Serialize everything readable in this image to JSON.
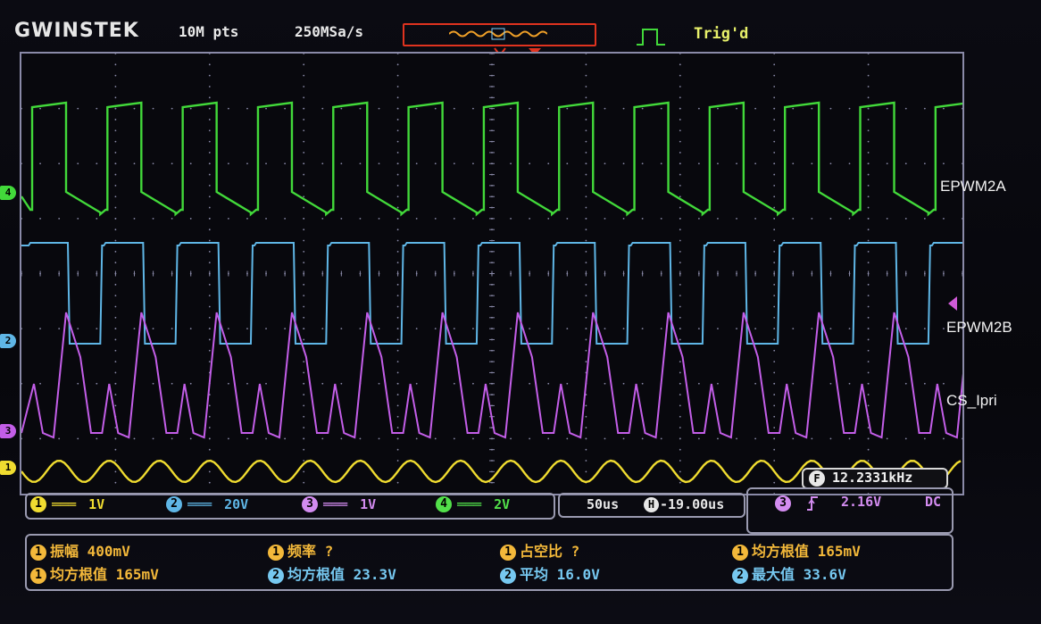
{
  "header": {
    "brand": "GWINSTEK",
    "record_length": "10M pts",
    "sample_rate": "250MSa/s",
    "trigger_status": "Trig'd"
  },
  "channels": [
    {
      "id": "1",
      "coupling": "DC",
      "scale": "1V",
      "color": "#f0dc30"
    },
    {
      "id": "2",
      "coupling": "DC",
      "scale": "20V",
      "color": "#5fb6e6"
    },
    {
      "id": "3",
      "coupling": "DC",
      "scale": "1V",
      "color": "#c35ee8"
    },
    {
      "id": "4",
      "coupling": "DC",
      "scale": "2V",
      "color": "#42d93a"
    }
  ],
  "timebase": {
    "scale": "50us",
    "position_icon": "H",
    "position": "-19.00us"
  },
  "trigger": {
    "source": "3",
    "slope_icon": "rising-edge-icon",
    "level": "2.16V",
    "coupling": "DC"
  },
  "frequency_counter": {
    "icon": "F",
    "value": "12.2331kHz"
  },
  "trace_labels": {
    "ch4": "EPWM2A",
    "ch2": "EPWM2B",
    "ch3": "CS_Ipri"
  },
  "measurements": [
    {
      "ch": "1",
      "label": "振幅",
      "value": "400mV",
      "color": "#f3b83a"
    },
    {
      "ch": "1",
      "label": "频率",
      "value": "?",
      "color": "#f3b83a"
    },
    {
      "ch": "1",
      "label": "占空比",
      "value": "?",
      "color": "#f3b83a"
    },
    {
      "ch": "1",
      "label": "均方根值",
      "value": "165mV",
      "color": "#f3b83a"
    },
    {
      "ch": "1",
      "label": "均方根值",
      "value": "165mV",
      "color": "#f3b83a"
    },
    {
      "ch": "2",
      "label": "均方根值",
      "value": "23.3V",
      "color": "#76c8f0"
    },
    {
      "ch": "2",
      "label": "平均",
      "value": "16.0V",
      "color": "#76c8f0"
    },
    {
      "ch": "2",
      "label": "最大值",
      "value": "33.6V",
      "color": "#76c8f0"
    }
  ],
  "colors": {
    "ch1": "#f0dc30",
    "ch2": "#5fb6e6",
    "ch3": "#c35ee8",
    "ch4": "#42d93a",
    "grid": "#8a8aa8",
    "trigger_marker": "#e0331f"
  }
}
